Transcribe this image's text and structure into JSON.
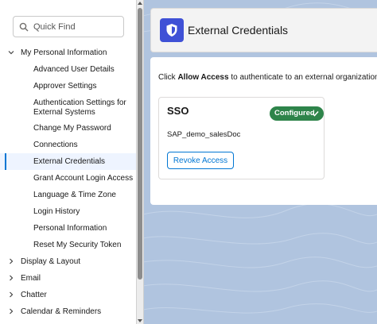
{
  "search": {
    "placeholder": "Quick Find"
  },
  "sidebar": {
    "sections": [
      {
        "label": "My Personal Information",
        "expanded": true
      },
      {
        "label": "Display & Layout",
        "expanded": false
      },
      {
        "label": "Email",
        "expanded": false
      },
      {
        "label": "Chatter",
        "expanded": false
      },
      {
        "label": "Calendar & Reminders",
        "expanded": false
      }
    ],
    "items": [
      {
        "label": "Advanced User Details"
      },
      {
        "label": "Approver Settings"
      },
      {
        "label": "Authentication Settings for External Systems"
      },
      {
        "label": "Change My Password"
      },
      {
        "label": "Connections"
      },
      {
        "label": "External Credentials",
        "active": true
      },
      {
        "label": "Grant Account Login Access"
      },
      {
        "label": "Language & Time Zone"
      },
      {
        "label": "Login History"
      },
      {
        "label": "Personal Information"
      },
      {
        "label": "Reset My Security Token"
      }
    ]
  },
  "header": {
    "title": "External Credentials",
    "icon": "shield-icon"
  },
  "main": {
    "instruction_prefix": "Click ",
    "instruction_bold": "Allow Access",
    "instruction_suffix": " to authenticate to an external organization.",
    "credential": {
      "name": "SSO",
      "status": "Configured",
      "principal": "SAP_demo_salesDoc",
      "revoke_label": "Revoke Access"
    }
  },
  "colors": {
    "accent": "#0176d3",
    "header_icon_bg": "#3f51d6",
    "badge_green": "#2e844a",
    "background": "#b0c4df"
  }
}
